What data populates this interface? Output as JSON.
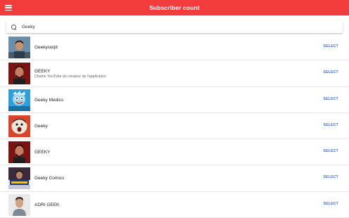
{
  "appbar": {
    "title": "Subscriber count",
    "menu_icon": "hamburger-menu-icon",
    "color": "#f23c3c"
  },
  "search": {
    "value": "Geeky",
    "icon": "search-icon"
  },
  "results": [
    {
      "name": "Geekyranjit",
      "subtitle": "",
      "action": "SELECT"
    },
    {
      "name": "GEEKY",
      "subtitle": "Chaîne YouTube du créateur de l'application",
      "action": "SELECT"
    },
    {
      "name": "Geeky Medics",
      "subtitle": "",
      "action": "SELECT"
    },
    {
      "name": "Geeky",
      "subtitle": "",
      "action": "SELECT"
    },
    {
      "name": "GEEKY",
      "subtitle": "",
      "action": "SELECT"
    },
    {
      "name": "Geeky Comics",
      "subtitle": "",
      "action": "SELECT"
    },
    {
      "name": "ADRI GEEK",
      "subtitle": "",
      "action": "SELECT"
    }
  ],
  "accent_color": "#3a6ed8"
}
